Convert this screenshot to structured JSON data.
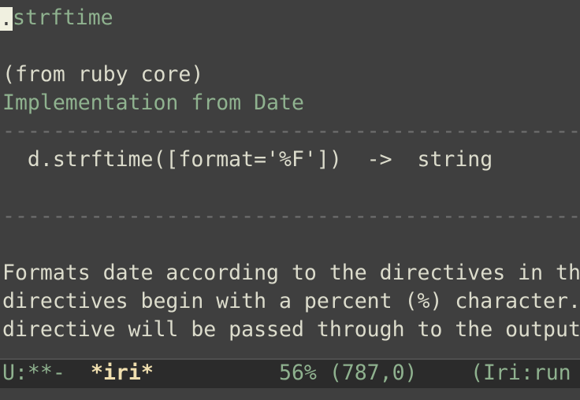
{
  "buffer": {
    "cursor_char": ".",
    "title": "strftime",
    "origin": "(from ruby core)",
    "implementation": "Implementation from Date",
    "rule1": "----------------------------------------------",
    "signature": "  d.strftime([format='%F'])  ->  string",
    "rule2": "----------------------------------------------",
    "para_line1": "Formats date according to the directives in th",
    "para_line2": "directives begin with a percent (%) character.",
    "para_line3": "directive will be passed through to the output"
  },
  "modeline": {
    "status": "U:**-",
    "buffer_name": "*iri*",
    "position": "56% (787,0)",
    "mode": "(Iri:run"
  },
  "colors": {
    "background": "#3f3f3f",
    "foreground": "#dcdccc",
    "accent_green": "#8fb28f",
    "modeline_bg": "#2b2b2b",
    "buffer_name": "#f0dfaf"
  }
}
